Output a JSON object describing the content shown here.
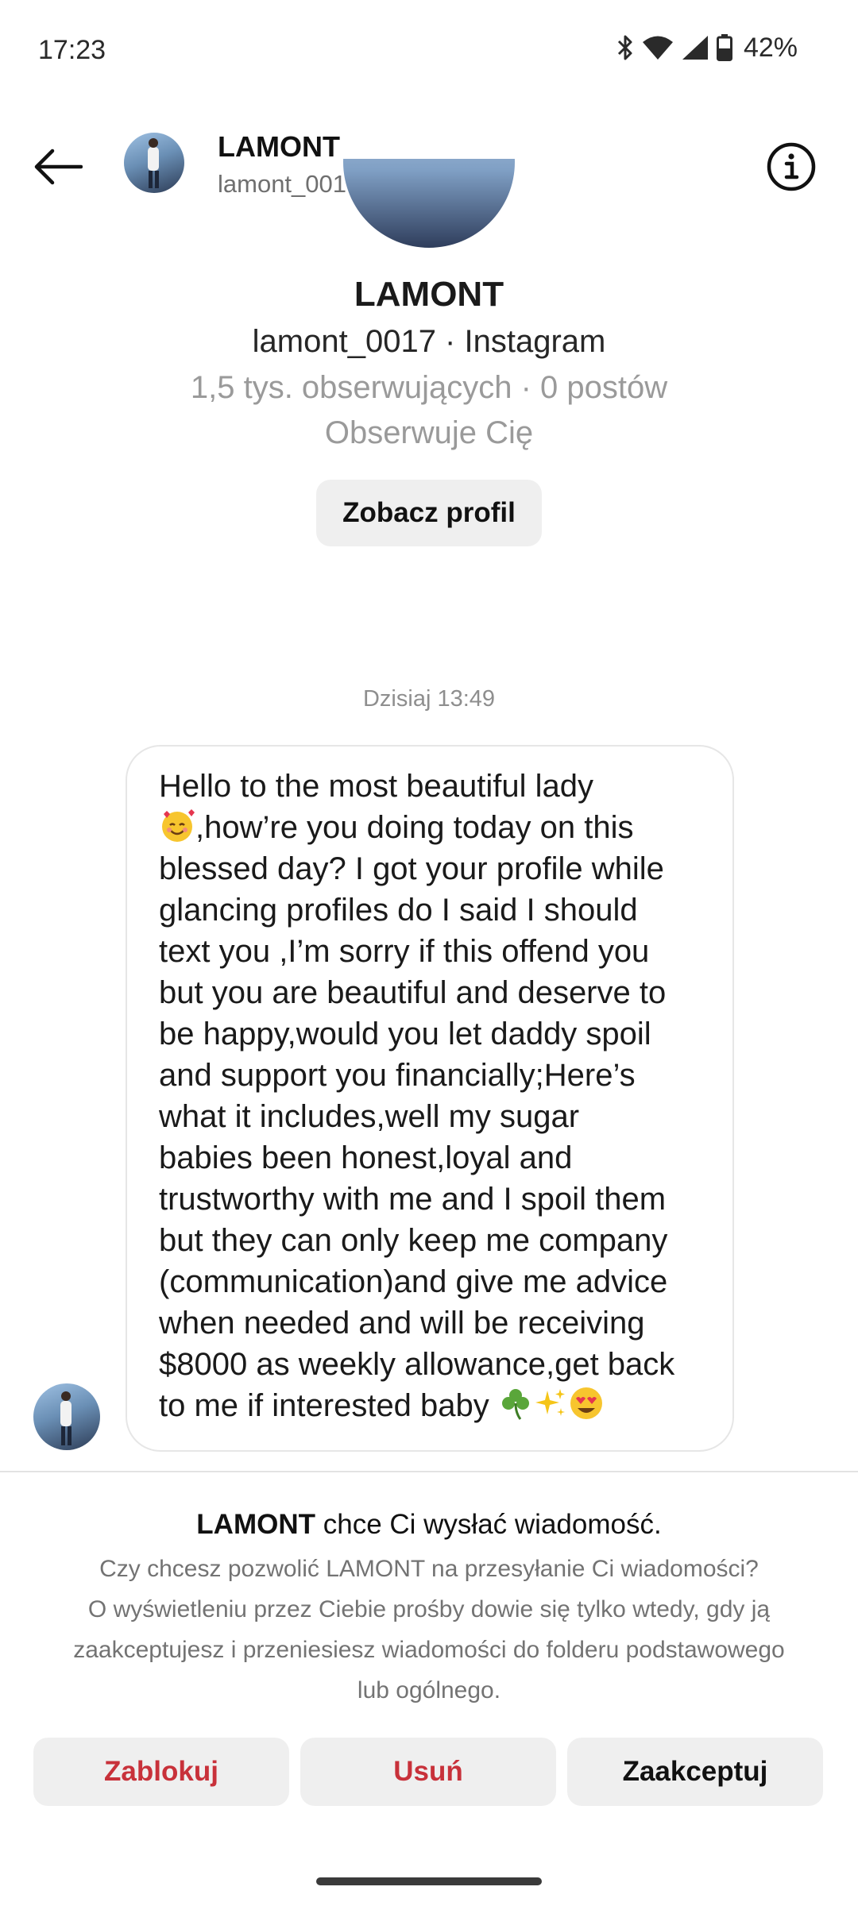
{
  "status_bar": {
    "time": "17:23",
    "battery_pct": "42%",
    "icons": [
      "bluetooth-icon",
      "wifi-icon",
      "signal-icon",
      "battery-icon"
    ]
  },
  "header": {
    "name": "LAMONT",
    "username": "lamont_0017",
    "back_icon": "arrow-left-icon",
    "info_icon": "info-icon"
  },
  "profile": {
    "name": "LAMONT",
    "handle_line": "lamont_0017 · Instagram",
    "stats_line": "1,5 tys. obserwujących · 0 postów",
    "follows_you": "Obserwuje Cię",
    "view_profile_label": "Zobacz profil"
  },
  "conversation": {
    "timestamp": "Dzisiaj 13:49",
    "message_lines": [
      "Hello to the most beautiful lady",
      ",how’re you doing today on this",
      "blessed day? I got your profile while",
      "glancing profiles do I said I should",
      "text you ,I’m sorry if this offend you",
      "but you are beautiful and deserve to",
      "be happy,would you let daddy spoil",
      "and support you financially;Here’s",
      "what it includes,well my sugar",
      "babies been honest,loyal and",
      "trustworthy with me and I spoil them",
      "but they can only keep me company",
      "(communication)and give me advice",
      "when needed and will be receiving",
      "$8000 as weekly allowance,get back",
      "to me if interested baby"
    ],
    "emojis": [
      "smiling-face-with-hearts",
      "shamrock",
      "sparkles",
      "heart-eyes"
    ]
  },
  "request": {
    "title_name": "LAMONT",
    "title_rest": " chce Ci wysłać wiadomość.",
    "body_lines": [
      "Czy chcesz pozwolić LAMONT na przesyłanie Ci wiadomości?",
      "O wyświetleniu przez Ciebie prośby dowie się tylko wtedy, gdy ją",
      "zaakceptujesz i przeniesiesz wiadomości do folderu podstawowego",
      "lub ogólnego."
    ],
    "block_label": "Zablokuj",
    "delete_label": "Usuń",
    "accept_label": "Zaakceptuj"
  },
  "colors": {
    "danger": "#c8313a",
    "button_bg": "#efefef",
    "muted_text": "#8e8e8e"
  }
}
